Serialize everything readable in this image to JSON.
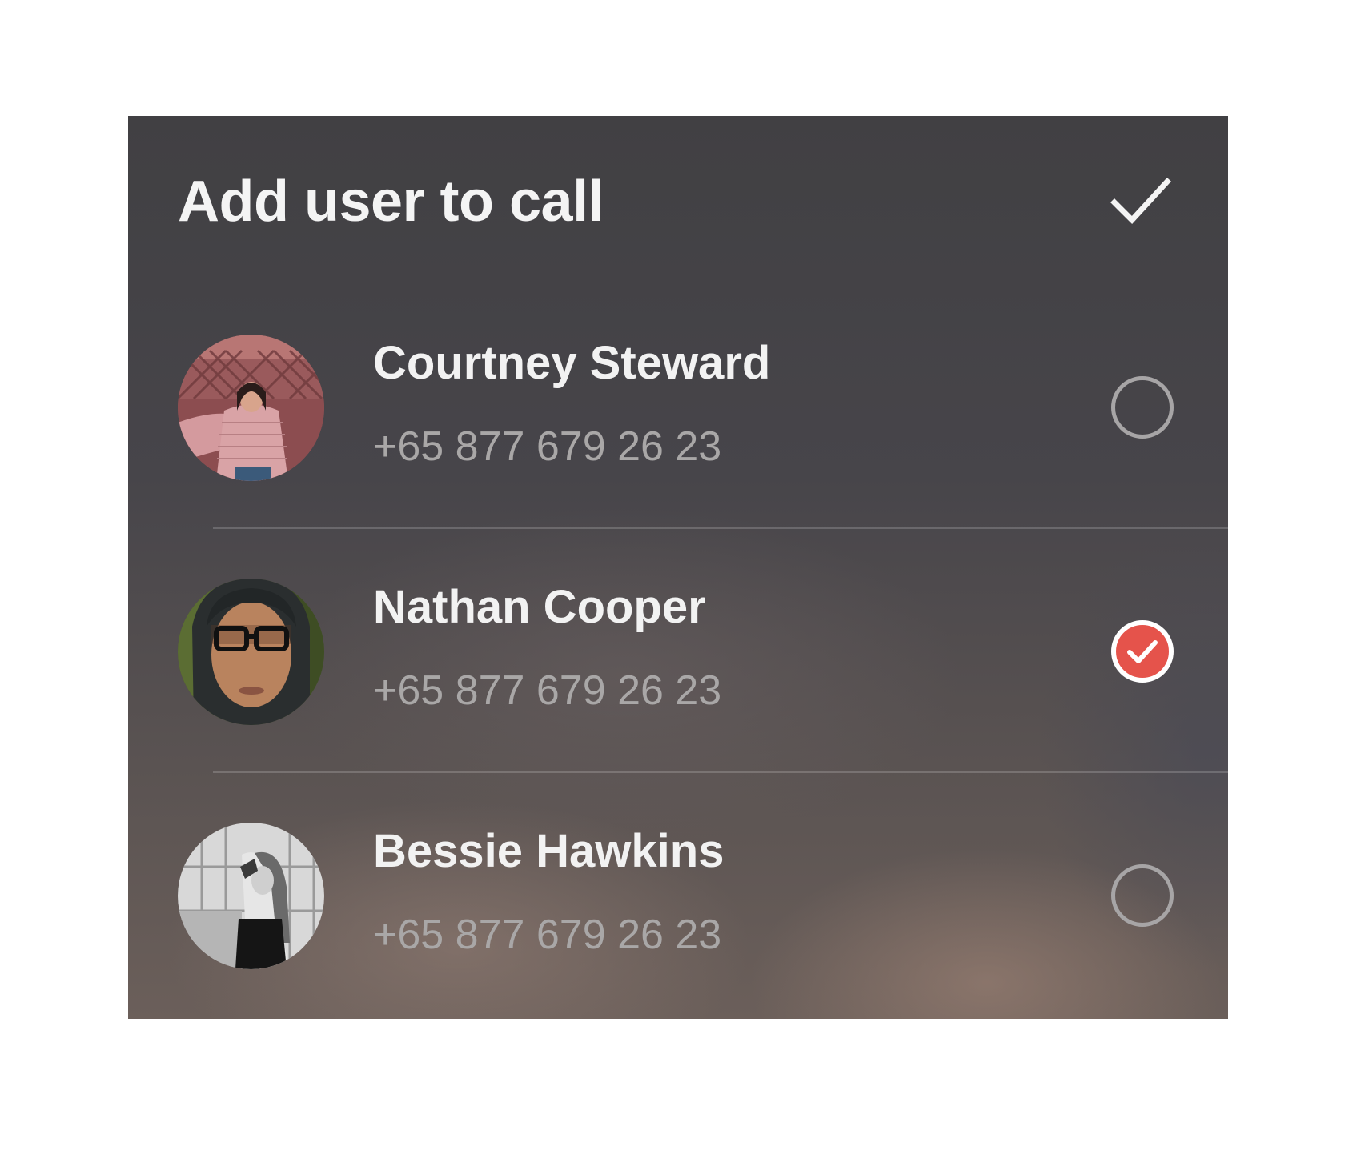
{
  "header": {
    "title": "Add user to call",
    "confirm_icon": "check-icon"
  },
  "contacts": [
    {
      "name": "Courtney Steward",
      "phone": "+65 877 679 26 23",
      "selected": false,
      "avatar": "avatar-photo"
    },
    {
      "name": "Nathan Cooper",
      "phone": "+65 877 679 26 23",
      "selected": true,
      "avatar": "avatar-photo"
    },
    {
      "name": "Bessie Hawkins",
      "phone": "+65 877 679 26 23",
      "selected": false,
      "avatar": "avatar-photo"
    }
  ],
  "colors": {
    "accent": "#e5534b",
    "title": "#f4f4f4",
    "phone": "#a9a7a7",
    "radio_border": "#a7a5a6"
  }
}
